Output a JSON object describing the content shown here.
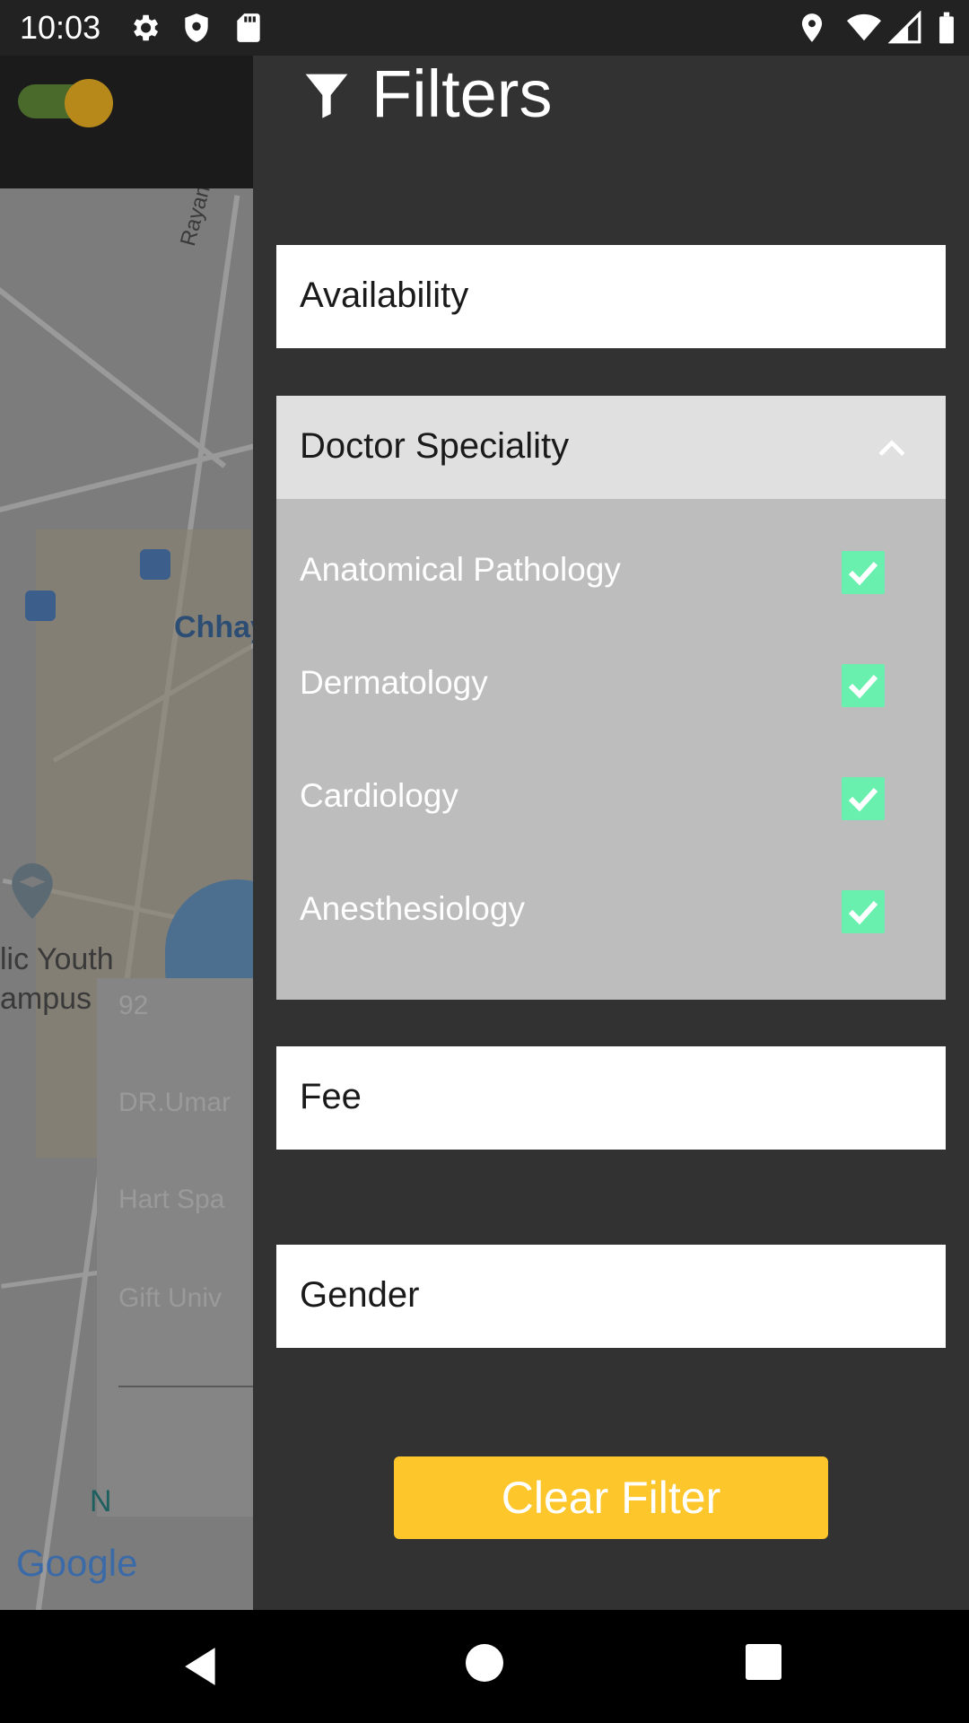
{
  "status_bar": {
    "time": "10:03",
    "left_icons": [
      "gear-icon",
      "shield-icon",
      "sd-card-icon"
    ],
    "right_icons": [
      "location-icon",
      "wifi-icon",
      "signal-icon",
      "battery-icon"
    ]
  },
  "background_map": {
    "street_label": "Rayamajhi M",
    "area_label": "Chhay",
    "place_label_line1": "lic Youth",
    "place_label_line2": "ampus",
    "card_text_1": "92",
    "card_text_2": "DR.Umar",
    "card_text_3": "Hart Spa",
    "card_text_4": "Gift Univ",
    "bottom_label": "N",
    "google_logo": "Google"
  },
  "drawer": {
    "title": "Filters",
    "sections": {
      "availability": "Availability",
      "doctor_speciality": "Doctor Speciality",
      "fee": "Fee",
      "gender": "Gender"
    },
    "speciality_options": [
      {
        "label": "Anatomical Pathology",
        "checked": true
      },
      {
        "label": "Dermatology",
        "checked": true
      },
      {
        "label": "Cardiology",
        "checked": true
      },
      {
        "label": "Anesthesiology",
        "checked": true
      }
    ],
    "clear_button": "Clear Filter"
  },
  "colors": {
    "drawer_bg": "#323232",
    "accent_yellow": "#fdc62b",
    "checkbox_green": "#69f0ae"
  }
}
